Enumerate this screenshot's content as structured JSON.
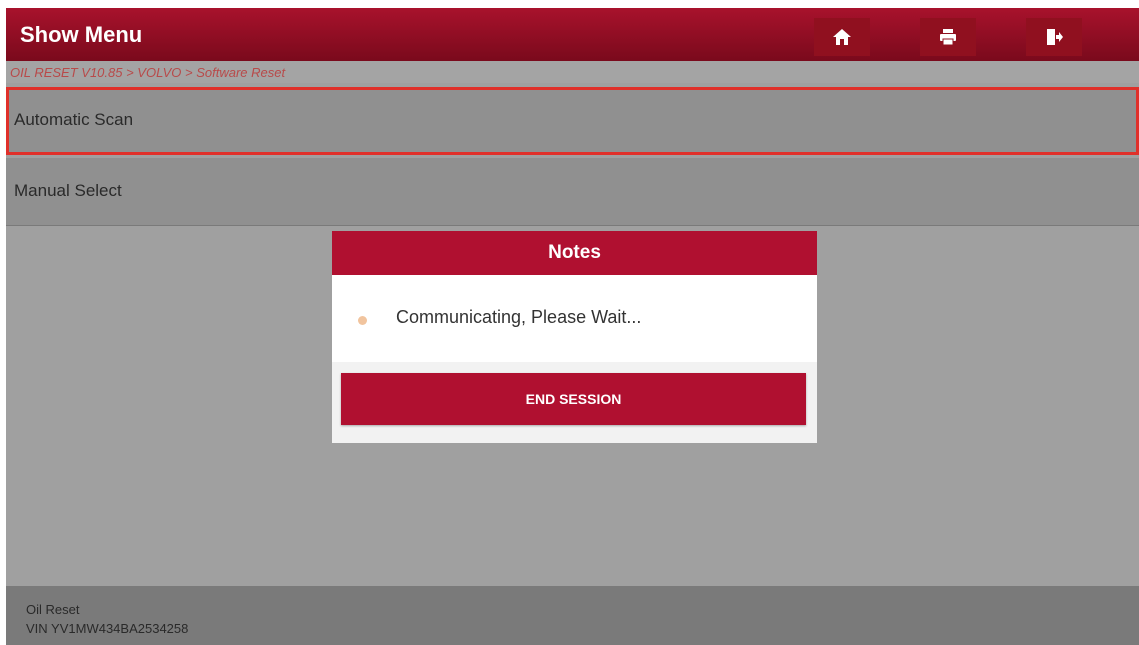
{
  "header": {
    "title": "Show Menu",
    "icons": {
      "home": "home-icon",
      "print": "print-icon",
      "exit": "exit-icon"
    }
  },
  "breadcrumb": "OIL RESET V10.85 > VOLVO > Software Reset",
  "menu": {
    "items": [
      {
        "label": "Automatic Scan",
        "highlighted": true
      },
      {
        "label": "Manual Select",
        "highlighted": false
      }
    ]
  },
  "dialog": {
    "title": "Notes",
    "message": "Communicating, Please Wait...",
    "button_label": "END SESSION"
  },
  "footer": {
    "line1": "Oil Reset",
    "line2": "VIN YV1MW434BA2534258"
  },
  "colors": {
    "header_red": "#a8122c",
    "accent_red": "#b01030",
    "highlight_border": "#e0302a",
    "status_dot": "#f1c49e",
    "breadcrumb_text": "#b84a4a"
  }
}
